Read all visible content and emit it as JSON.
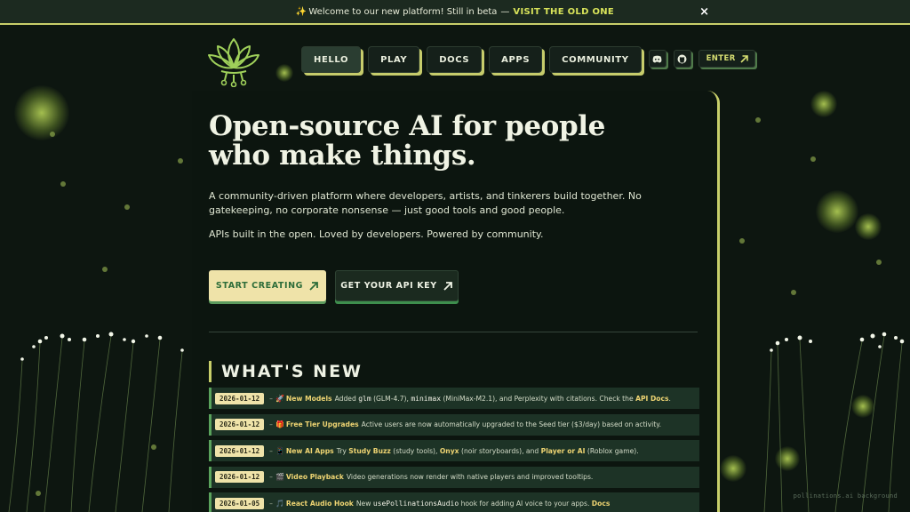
{
  "banner": {
    "spark": "✨",
    "message": "Welcome to our new platform! Still in beta",
    "separator": "—",
    "link": "VISIT THE OLD ONE",
    "close": "×"
  },
  "nav": {
    "items": [
      {
        "label": "HELLO"
      },
      {
        "label": "PLAY"
      },
      {
        "label": "DOCS"
      },
      {
        "label": "APPS"
      },
      {
        "label": "COMMUNITY"
      }
    ],
    "enter_label": "ENTER"
  },
  "hero": {
    "title": "Open-source AI for people who make things.",
    "description": "A community-driven platform where developers, artists, and tinkerers build together. No gatekeeping, no corporate nonsense — just good tools and good people.",
    "tagline": "APIs built in the open. Loved by developers. Powered by community.",
    "cta_primary": "START CREATING",
    "cta_secondary": "GET YOUR API KEY"
  },
  "news": {
    "title": "WHAT'S NEW",
    "items": [
      {
        "date": "2026-01-12",
        "dash": "–",
        "emoji": "🚀",
        "tag": "New Models",
        "t1": "Added",
        "m1": "glm",
        "t2": "(GLM-4.7),",
        "m2": "minimax",
        "t3": "(MiniMax-M2.1), and Perplexity with citations. Check the",
        "h1": "API Docs",
        "t4": "."
      },
      {
        "date": "2026-01-12",
        "dash": "–",
        "emoji": "🎁",
        "tag": "Free Tier Upgrades",
        "t1": "Active users are now automatically upgraded to the Seed tier ($3/day) based on activity."
      },
      {
        "date": "2026-01-12",
        "dash": "–",
        "emoji": "📱",
        "tag": "New AI Apps",
        "t1": "Try",
        "h1": "Study Buzz",
        "t2": "(study tools),",
        "h2": "Onyx",
        "t3": "(noir storyboards), and",
        "h3": "Player or AI",
        "t4": "(Roblox game)."
      },
      {
        "date": "2026-01-12",
        "dash": "–",
        "emoji": "🎬",
        "tag": "Video Playback",
        "t1": "Video generations now render with native players and improved tooltips."
      },
      {
        "date": "2026-01-05",
        "dash": "–",
        "emoji": "🎵",
        "tag": "React Audio Hook",
        "t1": "New",
        "m1": "usePollinationsAudio",
        "t2": "hook for adding AI voice to your apps.",
        "h1": "Docs"
      }
    ]
  },
  "credit": "pollinations.ai background",
  "colors": {
    "accent": "#c8cf6a",
    "background": "#0d1610",
    "cta_primary_bg": "#efe3a9",
    "highlight": "#eed472"
  }
}
